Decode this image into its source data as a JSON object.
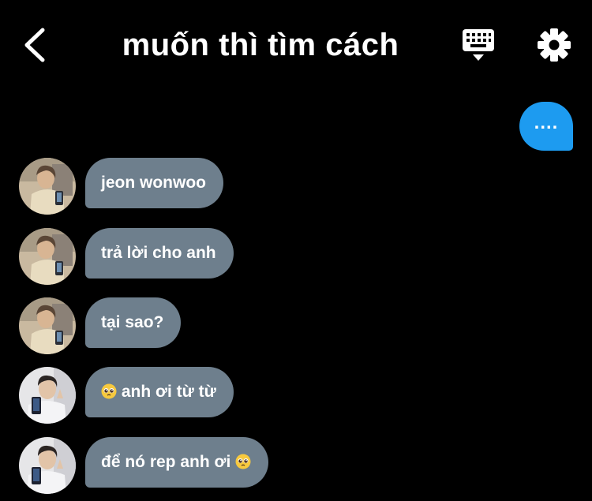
{
  "header": {
    "title": "muốn thì tìm cách",
    "back_icon": "chevron-left-icon",
    "keyboard_icon": "keyboard-icon",
    "settings_icon": "gear-icon"
  },
  "outgoing": {
    "text": "...."
  },
  "messages": [
    {
      "text": "jeon wonwoo",
      "avatar": "avatar-1"
    },
    {
      "text": "trả lời cho anh",
      "avatar": "avatar-1"
    },
    {
      "text": "tại sao?",
      "avatar": "avatar-1"
    },
    {
      "text": "anh ơi từ từ",
      "avatar": "avatar-2",
      "emoji": "pleading-face-emoji",
      "emoji_position": "before"
    },
    {
      "text": "để nó rep anh ơi",
      "avatar": "avatar-2",
      "emoji": "pleading-face-emoji",
      "emoji_position": "after"
    }
  ],
  "colors": {
    "background": "#000000",
    "outgoing_bubble": "#1d9bf0",
    "incoming_bubble": "#6e7f8d",
    "text": "#ffffff"
  }
}
